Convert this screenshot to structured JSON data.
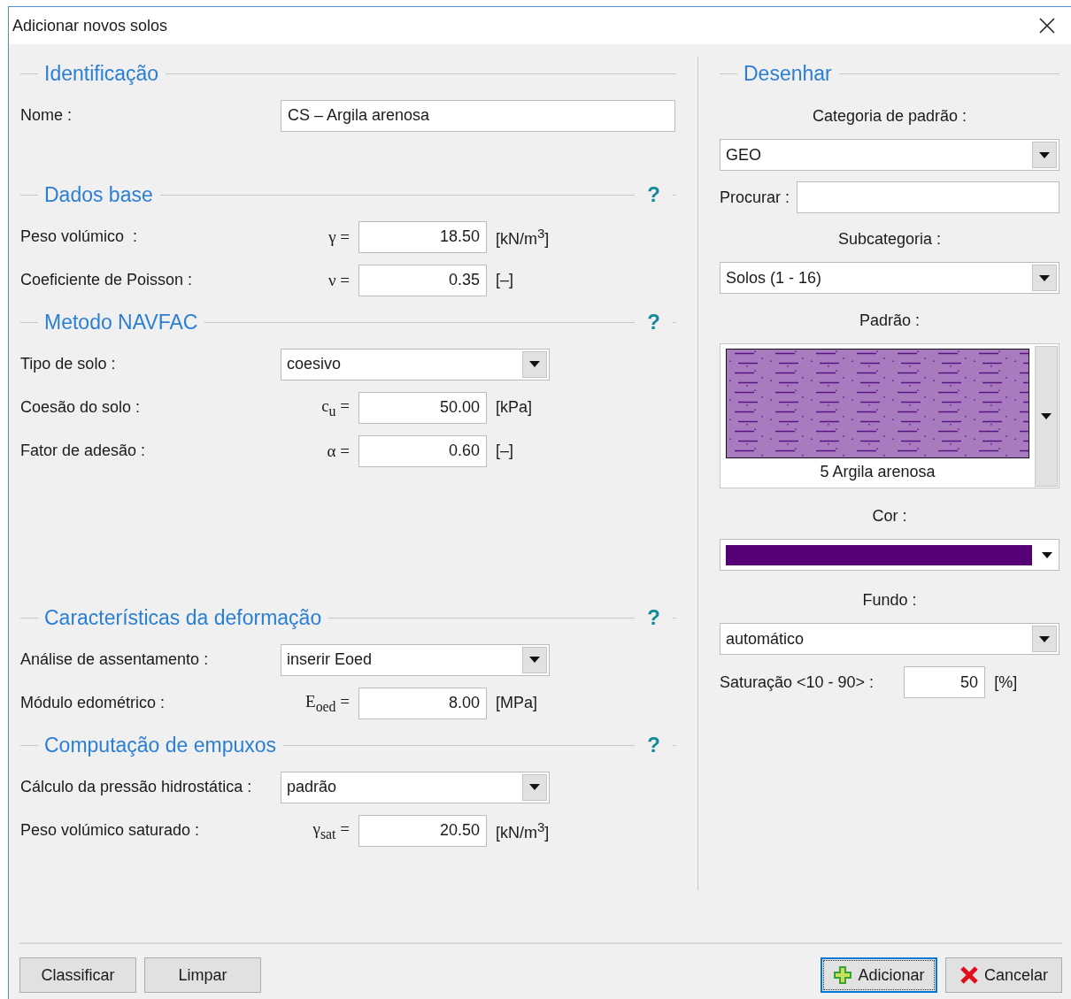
{
  "window": {
    "title": "Adicionar novos solos"
  },
  "sections": [
    {
      "title": "Identificação",
      "rows": [
        {
          "kind": "text",
          "label": "Nome :",
          "value": "CS – Argila arenosa"
        }
      ]
    },
    {
      "title": "Dados base",
      "help": "?",
      "rows": [
        {
          "kind": "number",
          "label": "Peso volúmico  :",
          "symbol": "γ =",
          "value": "18.50",
          "unit": "[kN/m$^{3}$]"
        },
        {
          "kind": "number",
          "label": "Coeficiente de Poisson :",
          "symbol": "ν =",
          "value": "0.35",
          "unit": "[–]"
        }
      ]
    },
    {
      "title": "Metodo NAVFAC",
      "help": "?",
      "rows": [
        {
          "kind": "dropdown",
          "label": "Tipo de solo :",
          "value": "coesivo"
        },
        {
          "kind": "number",
          "label": "Coesão do solo :",
          "symbol": "c$_{u}$ =",
          "value": "50.00",
          "unit": "[kPa]"
        },
        {
          "kind": "number",
          "label": "Fator de adesão :",
          "symbol": "α =",
          "value": "0.60",
          "unit": "[–]"
        }
      ]
    },
    {
      "title": "Características da deformação",
      "help": "?",
      "rows": [
        {
          "kind": "dropdown",
          "label": "Análise de assentamento :",
          "value": "inserir Eoed"
        },
        {
          "kind": "number",
          "label": "Módulo edométrico :",
          "symbol": "E$_{oed}$ =",
          "value": "8.00",
          "unit": "[MPa]"
        }
      ]
    },
    {
      "title": "Computação de empuxos",
      "help": "?",
      "rows": [
        {
          "kind": "dropdown",
          "label": "Cálculo da pressão hidrostática :",
          "value": "padrão"
        },
        {
          "kind": "number",
          "label": "Peso volúmico saturado :",
          "symbol": "γ$_{sat}$ =",
          "value": "20.50",
          "unit": "[kN/m$^{3}$]"
        }
      ]
    }
  ],
  "draw": {
    "title": "Desenhar",
    "category": {
      "label": "Categoria de padrão :",
      "value": "GEO"
    },
    "search": {
      "label": "Procurar :"
    },
    "subcategory": {
      "label": "Subcategoria :",
      "value": "Solos (1 - 16)"
    },
    "pattern": {
      "label": "Padrão :",
      "name": "5 Argila arenosa"
    },
    "color": {
      "label": "Cor :",
      "color": "#560078"
    },
    "background": {
      "label": "Fundo :",
      "value": "automático"
    },
    "saturation": {
      "label": "Saturação <10 - 90> :",
      "value": "50",
      "unit": "[%]"
    }
  },
  "footer": {
    "left_buttons": [
      {
        "label": "Classificar"
      },
      {
        "label": "Limpar"
      }
    ],
    "right_buttons": [
      {
        "label": "Adicionar",
        "kind": "add",
        "focused": true
      },
      {
        "label": "Cancelar",
        "kind": "cancel",
        "focused": false
      }
    ]
  }
}
